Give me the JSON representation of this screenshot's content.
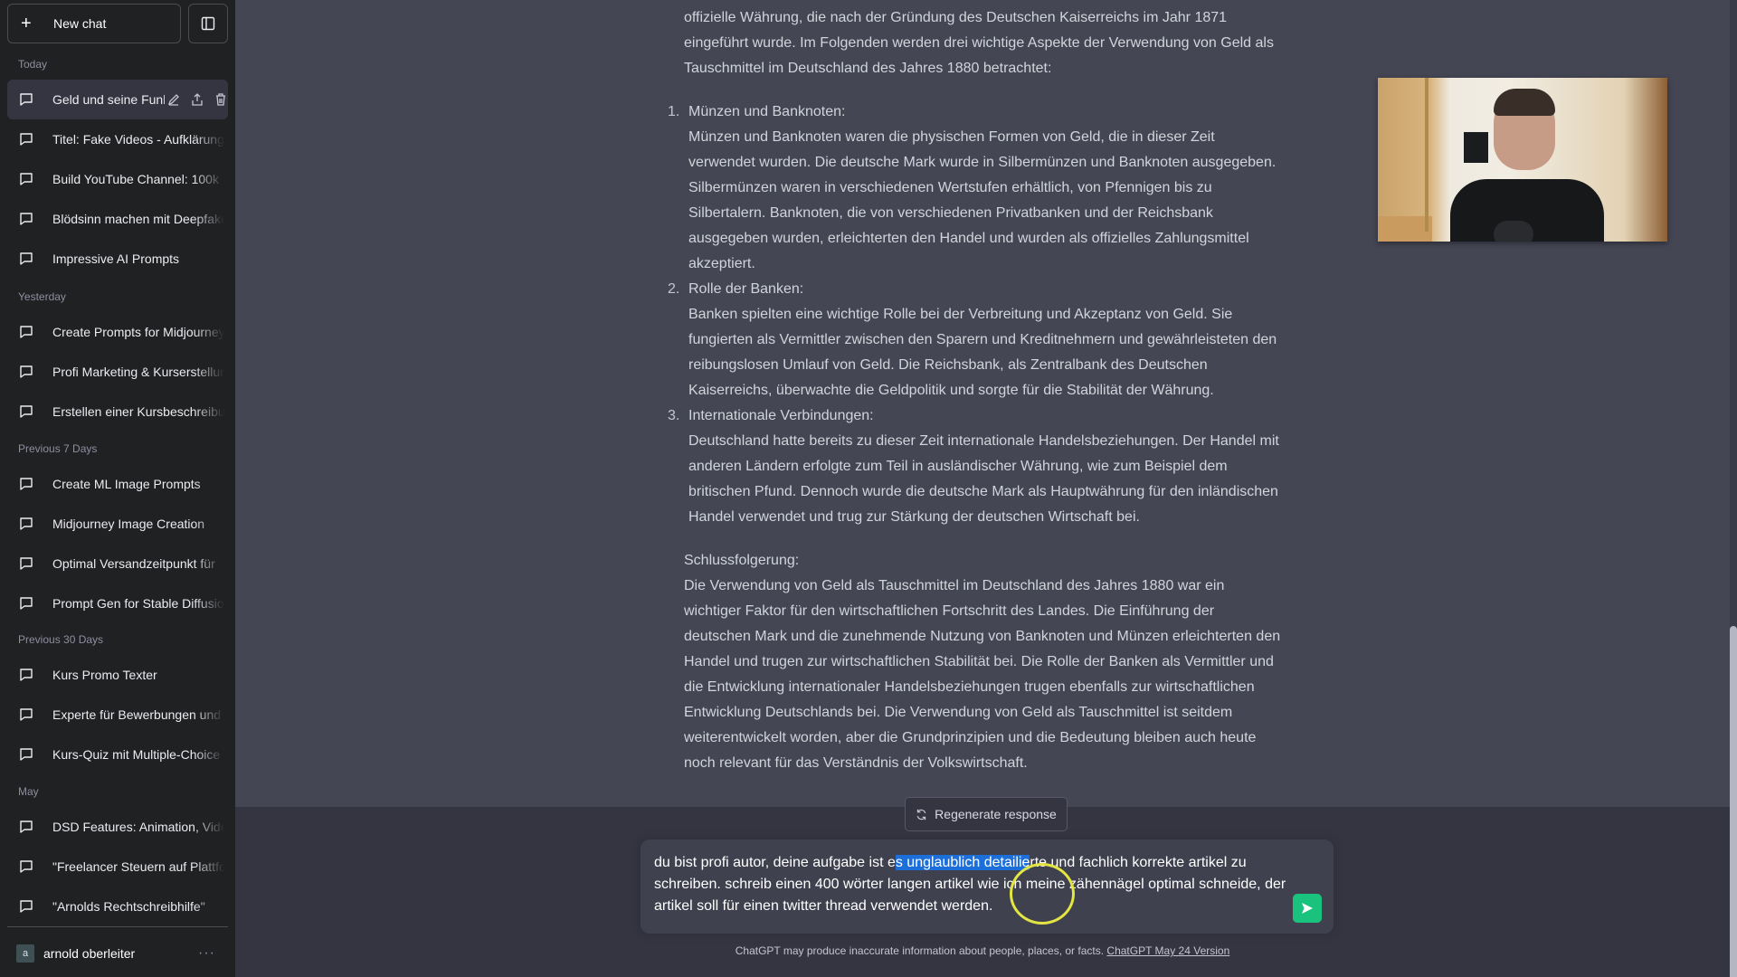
{
  "sidebar": {
    "new_chat_label": "New chat",
    "sections": [
      {
        "label": "Today",
        "items": [
          {
            "title": "Geld und seine Funktion",
            "active": true
          },
          {
            "title": "Titel: Fake Videos - Aufklärung"
          },
          {
            "title": "Build YouTube Channel: 100k"
          },
          {
            "title": "Blödsinn machen mit Deepfakes"
          },
          {
            "title": "Impressive AI Prompts"
          }
        ]
      },
      {
        "label": "Yesterday",
        "items": [
          {
            "title": "Create Prompts for Midjourney"
          },
          {
            "title": "Profi Marketing & Kurserstellung"
          },
          {
            "title": "Erstellen einer Kursbeschreibung"
          }
        ]
      },
      {
        "label": "Previous 7 Days",
        "items": [
          {
            "title": "Create ML Image Prompts"
          },
          {
            "title": "Midjourney Image Creation"
          },
          {
            "title": "Optimal Versandzeitpunkt für"
          },
          {
            "title": "Prompt Gen for Stable Diffusion"
          }
        ]
      },
      {
        "label": "Previous 30 Days",
        "items": [
          {
            "title": "Kurs Promo Texter"
          },
          {
            "title": "Experte für Bewerbungen und"
          },
          {
            "title": "Kurs-Quiz mit Multiple-Choice"
          }
        ]
      },
      {
        "label": "May",
        "items": [
          {
            "title": "DSD Features: Animation, Video"
          },
          {
            "title": "\"Freelancer Steuern auf Plattform"
          },
          {
            "title": "\"Arnolds Rechtschreibhilfe\""
          }
        ]
      }
    ],
    "user": {
      "initial": "a",
      "name": "arnold oberleiter",
      "more": "···"
    }
  },
  "message": {
    "intro": "offizielle Währung, die nach der Gründung des Deutschen Kaiserreichs im Jahr 1871 eingeführt wurde. Im Folgenden werden drei wichtige Aspekte der Verwendung von Geld als Tauschmittel im Deutschland des Jahres 1880 betrachtet:",
    "points": [
      {
        "num": "1.",
        "heading": "Münzen und Banknoten:",
        "body": "Münzen und Banknoten waren die physischen Formen von Geld, die in dieser Zeit verwendet wurden. Die deutsche Mark wurde in Silbermünzen und Banknoten ausgegeben. Silbermünzen waren in verschiedenen Wertstufen erhältlich, von Pfennigen bis zu Silbertalern. Banknoten, die von verschiedenen Privatbanken und der Reichsbank ausgegeben wurden, erleichterten den Handel und wurden als offizielles Zahlungsmittel akzeptiert."
      },
      {
        "num": "2.",
        "heading": "Rolle der Banken:",
        "body": "Banken spielten eine wichtige Rolle bei der Verbreitung und Akzeptanz von Geld. Sie fungierten als Vermittler zwischen den Sparern und Kreditnehmern und gewährleisteten den reibungslosen Umlauf von Geld. Die Reichsbank, als Zentralbank des Deutschen Kaiserreichs, überwachte die Geldpolitik und sorgte für die Stabilität der Währung."
      },
      {
        "num": "3.",
        "heading": "Internationale Verbindungen:",
        "body": "Deutschland hatte bereits zu dieser Zeit internationale Handelsbeziehungen. Der Handel mit anderen Ländern erfolgte zum Teil in ausländischer Währung, wie zum Beispiel dem britischen Pfund. Dennoch wurde die deutsche Mark als Hauptwährung für den inländischen Handel verwendet und trug zur Stärkung der deutschen Wirtschaft bei."
      }
    ],
    "conclusion_heading": "Schlussfolgerung:",
    "conclusion": "Die Verwendung von Geld als Tauschmittel im Deutschland des Jahres 1880 war ein wichtiger Faktor für den wirtschaftlichen Fortschritt des Landes. Die Einführung der deutschen Mark und die zunehmende Nutzung von Banknoten und Münzen erleichterten den Handel und trugen zur wirtschaftlichen Stabilität bei. Die Rolle der Banken als Vermittler und die Entwicklung internationaler Handelsbeziehungen trugen ebenfalls zur wirtschaftlichen Entwicklung Deutschlands bei. Die Verwendung von Geld als Tauschmittel ist seitdem weiterentwickelt worden, aber die Grundprinzipien und die Bedeutung bleiben auch heute noch relevant für das Verständnis der Volkswirtschaft."
  },
  "composer": {
    "regenerate_label": "Regenerate response",
    "input_before": "du bist profi autor, deine aufgabe ist e",
    "input_selected": "s unglaublich detailie",
    "input_after": "rte und fachlich korrekte artikel zu schreiben. schreib einen 400 wörter langen artikel wie ich meine zähennägel optimal schneide, der artikel soll für einen twitter thread verwendet werden.",
    "send_color": "#19c37d"
  },
  "footer": {
    "disclaimer": "ChatGPT may produce inaccurate information about people, places, or facts. ",
    "version_link": "ChatGPT May 24 Version"
  },
  "colors": {
    "sidebar_bg": "#202123",
    "main_bg": "#444654",
    "bottom_bg": "#343541",
    "input_bg": "#40414f",
    "selection": "#1c6fd8",
    "accent": "#19c37d"
  }
}
